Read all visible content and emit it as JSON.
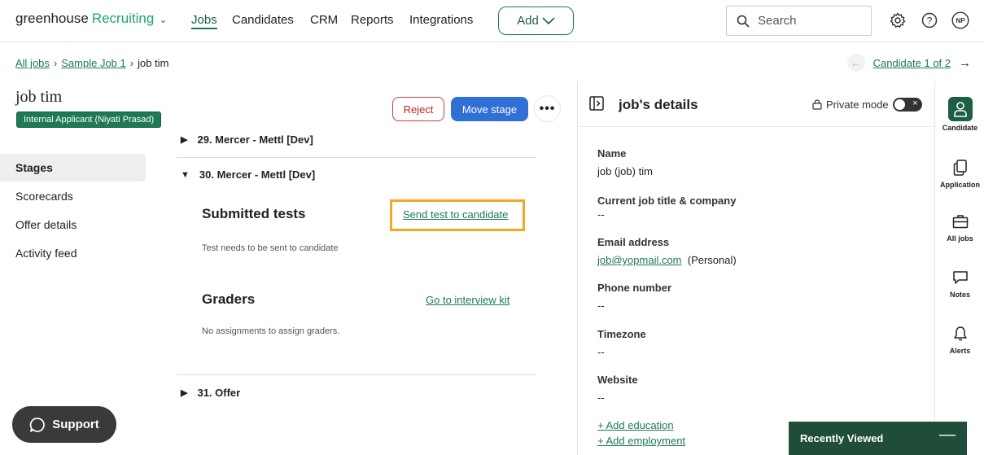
{
  "nav": {
    "brand": "greenhouse",
    "product": "Recruiting",
    "links": [
      "Jobs",
      "Candidates",
      "CRM",
      "Reports",
      "Integrations"
    ],
    "add_label": "Add",
    "search_placeholder": "Search",
    "avatar_initials": "NP"
  },
  "breadcrumb": {
    "all_jobs": "All jobs",
    "job": "Sample Job 1",
    "current": "job tim",
    "candidate_counter": "Candidate 1 of 2"
  },
  "candidate": {
    "name": "job tim",
    "badge": "Internal Applicant (Niyati Prasad)"
  },
  "actions": {
    "reject": "Reject",
    "move_stage": "Move stage",
    "more": "•••"
  },
  "sidebar": {
    "items": [
      {
        "label": "Stages",
        "active": true
      },
      {
        "label": "Scorecards",
        "active": false
      },
      {
        "label": "Offer details",
        "active": false
      },
      {
        "label": "Activity feed",
        "active": false
      }
    ]
  },
  "stages": {
    "stage_29": "29. Mercer - Mettl [Dev]",
    "stage_30": "30. Mercer - Mettl [Dev]",
    "stage_31": "31. Offer",
    "submitted_title": "Submitted tests",
    "send_test_link": "Send test to candidate",
    "submitted_note": "Test needs to be sent to candidate",
    "graders_title": "Graders",
    "interview_kit_link": "Go to interview kit",
    "graders_note": "No assignments to assign graders."
  },
  "details": {
    "title": "job's details",
    "private_mode": "Private mode",
    "fields": [
      {
        "label": "Name",
        "value": "job (job) tim"
      },
      {
        "label": "Current job title & company",
        "value": "--"
      },
      {
        "label": "Email address",
        "value": "job@yopmail.com",
        "suffix": "(Personal)"
      },
      {
        "label": "Phone number",
        "value": "--"
      },
      {
        "label": "Timezone",
        "value": "--"
      },
      {
        "label": "Website",
        "value": "--"
      }
    ],
    "add_education": "+ Add education",
    "add_employment": "+ Add employment"
  },
  "rail": {
    "items": [
      "Candidate",
      "Application",
      "All jobs",
      "Notes",
      "Alerts"
    ]
  },
  "footer": {
    "support": "Support",
    "recently_viewed": "Recently Viewed"
  },
  "colors": {
    "brand_green": "#1d7a55",
    "primary_blue": "#2f6fd6",
    "reject_red": "#cc3d3d",
    "highlight": "#f5a623"
  }
}
